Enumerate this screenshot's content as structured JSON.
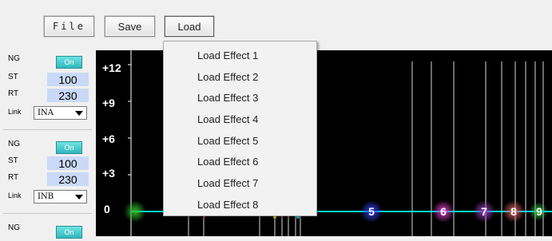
{
  "toolbar": {
    "file_label": "File",
    "save_label": "Save",
    "load_label": "Load"
  },
  "load_menu": {
    "items": [
      "Load Effect 1",
      "Load Effect 2",
      "Load Effect 3",
      "Load Effect 4",
      "Load Effect 5",
      "Load Effect 6",
      "Load Effect 7",
      "Load Effect 8"
    ]
  },
  "channels": [
    {
      "ng_label": "NG",
      "ng_button": "On",
      "st_label": "ST",
      "st_value": "100",
      "rt_label": "RT",
      "rt_value": "230",
      "link_label": "Link",
      "link_value": "INA"
    },
    {
      "ng_label": "NG",
      "ng_button": "On",
      "st_label": "ST",
      "st_value": "100",
      "rt_label": "RT",
      "rt_value": "230",
      "link_label": "Link",
      "link_value": "INB"
    },
    {
      "ng_label": "NG",
      "ng_button": "On"
    }
  ],
  "graph": {
    "y_ticks": [
      "+12",
      "+9",
      "+6",
      "+3",
      "0"
    ],
    "line_color": "#00d8e8",
    "markers": [
      {
        "label": "5",
        "color": "#2a33d8"
      },
      {
        "label": "6",
        "color": "#c02ab8"
      },
      {
        "label": "7",
        "color": "#7a2a9a"
      },
      {
        "label": "8",
        "color": "#c24a4a"
      },
      {
        "label": "9",
        "color": "#1f8f2a"
      }
    ]
  },
  "colors": {
    "on_button": "#3cc4c9",
    "value_field": "#c9d9f7",
    "graph_bg": "#000000"
  }
}
